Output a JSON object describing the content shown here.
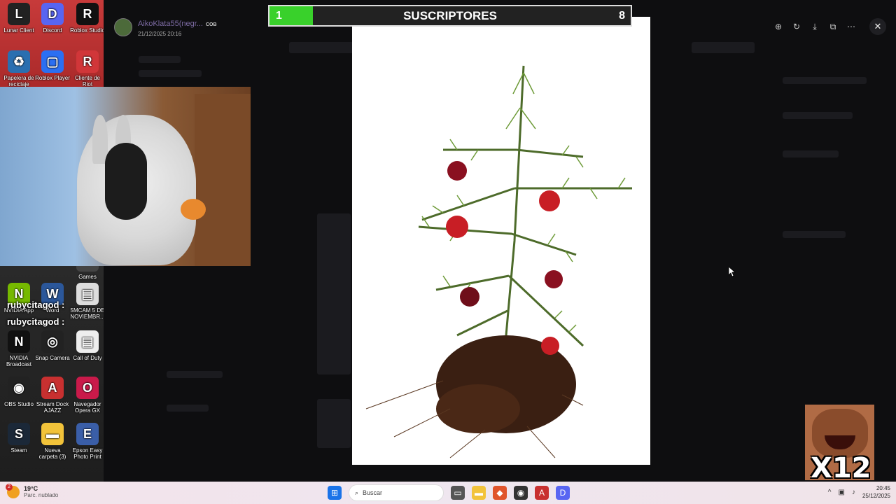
{
  "desktop": {
    "icons": [
      {
        "label": "Lunar Client",
        "glyph": "L",
        "color": "#222"
      },
      {
        "label": "Discord",
        "glyph": "D",
        "color": "#5865f2"
      },
      {
        "label": "Roblox Studio",
        "glyph": "R",
        "color": "#111"
      },
      {
        "label": "Papelera de reciclaje",
        "glyph": "♻",
        "color": "#2a6fb0"
      },
      {
        "label": "Roblox Player",
        "glyph": "▢",
        "color": "#2b6ff2"
      },
      {
        "label": "Cliente de Riot",
        "glyph": "R",
        "color": "#d13639"
      },
      {
        "label": "Games",
        "glyph": "G",
        "color": "#444"
      },
      {
        "label": "NVIDIA App",
        "glyph": "N",
        "color": "#76b900"
      },
      {
        "label": "Word",
        "glyph": "W",
        "color": "#2b579a"
      },
      {
        "label": "5MCAM 5 DE NOVIEMBR...",
        "glyph": "▤",
        "color": "#ddd"
      },
      {
        "label": "NVIDIA Broadcast",
        "glyph": "N",
        "color": "#111"
      },
      {
        "label": "Snap Camera",
        "glyph": "◎",
        "color": "#222"
      },
      {
        "label": "Call of Duty",
        "glyph": "▤",
        "color": "#eee"
      },
      {
        "label": "OBS Studio",
        "glyph": "◉",
        "color": "#222"
      },
      {
        "label": "Stream Dock AJAZZ",
        "glyph": "A",
        "color": "#c83030"
      },
      {
        "label": "Navegador Opera GX",
        "glyph": "O",
        "color": "#c91a4a"
      },
      {
        "label": "Steam",
        "glyph": "S",
        "color": "#1b2838"
      },
      {
        "label": "Nueva carpeta (3)",
        "glyph": "▬",
        "color": "#f2c33a"
      },
      {
        "label": "Epson Easy Photo Print",
        "glyph": "E",
        "color": "#3a5ea8"
      }
    ],
    "chat_lines": [
      "rubycitagod :",
      "rubycitagod :"
    ]
  },
  "viewer": {
    "username": "AikoKlata55(negr...",
    "date": "21/12/2025 20:16",
    "badge": "COB",
    "tools": [
      "zoom-in-icon",
      "rotate-icon",
      "download-icon",
      "open-external-icon",
      "more-icon"
    ],
    "close_glyph": "✕"
  },
  "subscriber_bar": {
    "current": "1",
    "title": "SUSCRIPTORES",
    "goal": "8",
    "progress_fraction": 0.12,
    "fill_color": "#39d12b"
  },
  "meme_overlay": {
    "multiplier": "X12"
  },
  "taskbar": {
    "weather_temp": "19°C",
    "weather_desc": "Parc. nublado",
    "weather_badge": "2",
    "search_placeholder": "Buscar",
    "time": "20:45",
    "date": "25/12/2025"
  }
}
